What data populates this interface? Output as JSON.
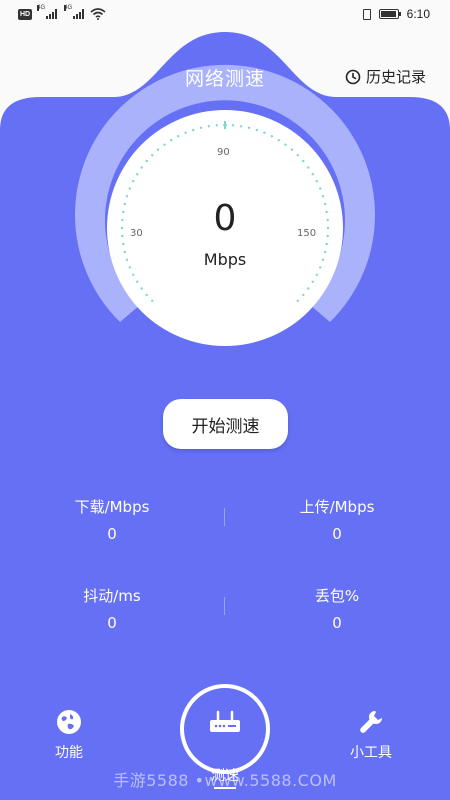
{
  "status_bar": {
    "hd_badge": "HD",
    "network_left": "4G",
    "network_right": "4G",
    "time": "6:10",
    "battery_level_pct": 90
  },
  "header": {
    "title": "网络测速",
    "history_label": "历史记录"
  },
  "gauge": {
    "value": "0",
    "unit": "Mbps",
    "ticks": [
      "30",
      "90",
      "150"
    ],
    "accent_color": "#7fd6cf",
    "track_color": "#a9b2fb",
    "face_color": "#ffffff"
  },
  "start_button": {
    "label": "开始测速"
  },
  "stats": [
    {
      "label": "下载/Mbps",
      "value": "0"
    },
    {
      "label": "上传/Mbps",
      "value": "0"
    },
    {
      "label": "抖动/ms",
      "value": "0"
    },
    {
      "label": "丢包%",
      "value": "0"
    }
  ],
  "nav": {
    "features_label": "功能",
    "speedtest_label": "测速",
    "tools_label": "小工具"
  },
  "watermark": "手游5588 •www.5588.COM",
  "colors": {
    "primary": "#6570f5",
    "background": "#fafafa"
  }
}
